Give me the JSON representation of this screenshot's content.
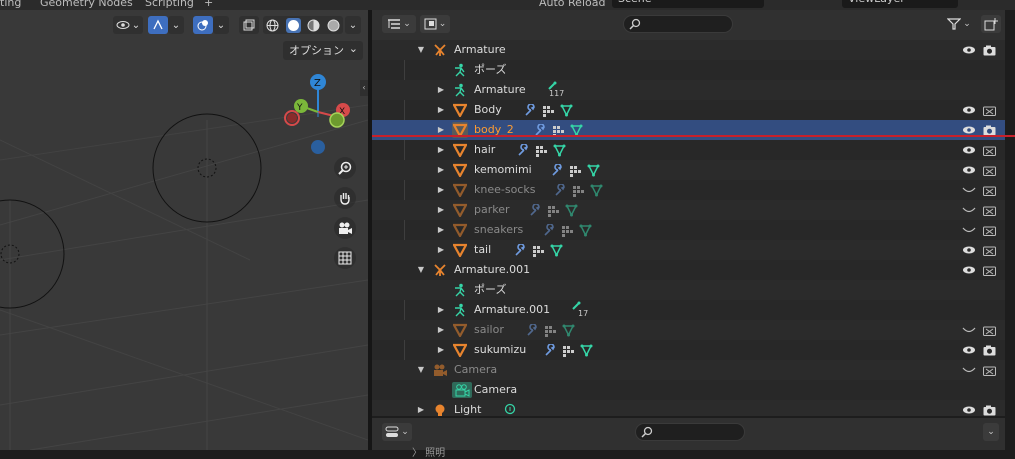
{
  "topbar": {
    "tabs": [
      "ting",
      "Geometry Nodes",
      "Scripting",
      "+"
    ],
    "auto_reload": "Auto Reload",
    "scene_name": "Scene",
    "view_layer": "ViewLayer"
  },
  "viewport": {
    "options_label": "オプション",
    "gizmo": {
      "z": "Z",
      "y": "Y",
      "x": "X"
    }
  },
  "outliner": {
    "rows": [
      {
        "label": "Armature",
        "kind": "armature",
        "expanded": true
      },
      {
        "label": "ポーズ",
        "kind": "pose"
      },
      {
        "label": "Armature",
        "kind": "armature-data",
        "badge": "117"
      },
      {
        "label": "Body",
        "kind": "mesh"
      },
      {
        "label": "body_2",
        "kind": "mesh",
        "selected": true
      },
      {
        "label": "hair",
        "kind": "mesh"
      },
      {
        "label": "kemomimi",
        "kind": "mesh"
      },
      {
        "label": "knee-socks",
        "kind": "mesh",
        "hidden": true
      },
      {
        "label": "parker",
        "kind": "mesh",
        "hidden": true
      },
      {
        "label": "sneakers",
        "kind": "mesh",
        "hidden": true
      },
      {
        "label": "tail",
        "kind": "mesh"
      },
      {
        "label": "Armature.001",
        "kind": "armature",
        "expanded": true
      },
      {
        "label": "ポーズ",
        "kind": "pose"
      },
      {
        "label": "Armature.001",
        "kind": "armature-data",
        "badge": "17"
      },
      {
        "label": "sailor",
        "kind": "mesh",
        "hidden": true
      },
      {
        "label": "sukumizu",
        "kind": "mesh"
      },
      {
        "label": "Camera",
        "kind": "camera",
        "expanded": true,
        "hidden": true
      },
      {
        "label": "Camera",
        "kind": "camera-data"
      },
      {
        "label": "Light",
        "kind": "light"
      }
    ]
  },
  "properties": {
    "clipped_label": "〉 照明"
  },
  "colors": {
    "selection": "#334d80",
    "object_orange": "#e8842e",
    "modifier_blue": "#6f9be0",
    "mesh_green": "#35d5a7",
    "annotation_red": "#c8202a"
  }
}
